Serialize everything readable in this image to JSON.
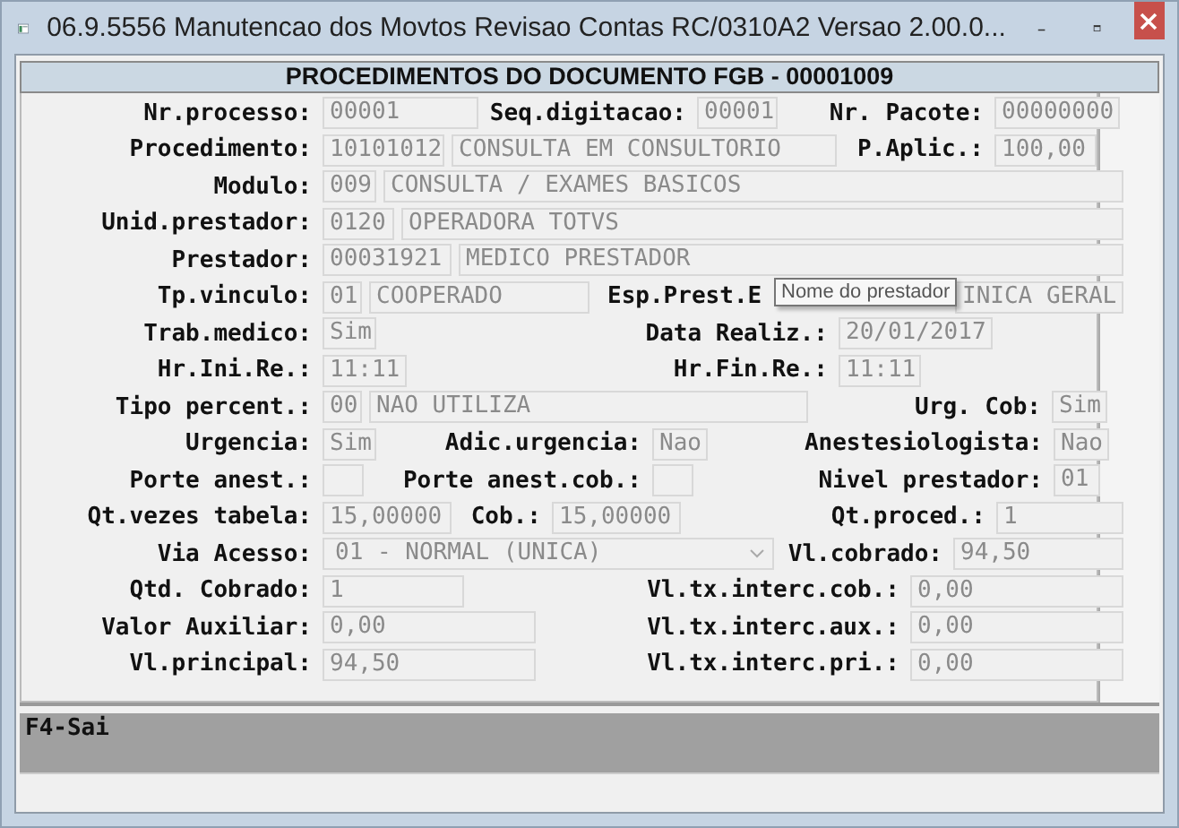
{
  "window": {
    "title": "06.9.5556 Manutencao  dos Movtos Revisao Contas RC/0310A2 Versao 2.00.0..."
  },
  "header": "PROCEDIMENTOS DO DOCUMENTO FGB - 00001009",
  "form_rows": [
    [
      {
        "label": "Nr.processo:",
        "kind": "text",
        "values": [
          "00001"
        ]
      },
      {
        "label": "Seq.digitacao:",
        "kind": "text",
        "values": [
          "00001"
        ]
      },
      {
        "label": "Nr. Pacote:",
        "kind": "text",
        "values": [
          "00000000"
        ]
      }
    ],
    [
      {
        "label": "Procedimento:",
        "kind": "text",
        "values": [
          "10101012",
          "CONSULTA EM CONSULTORIO"
        ]
      },
      {
        "label": "P.Aplic.:",
        "kind": "text",
        "values": [
          "100,00"
        ]
      }
    ],
    [
      {
        "label": "Modulo:",
        "kind": "text",
        "values": [
          "009",
          "CONSULTA / EXAMES BASICOS"
        ]
      }
    ],
    [
      {
        "label": "Unid.prestador:",
        "kind": "text",
        "values": [
          "0120",
          "OPERADORA TOTVS"
        ]
      }
    ],
    [
      {
        "label": "Prestador:",
        "kind": "text",
        "values": [
          "00031921",
          "MEDICO PRESTADOR"
        ]
      }
    ],
    [
      {
        "label": "Tp.vinculo:",
        "kind": "text",
        "values": [
          "01",
          "COOPERADO"
        ]
      },
      {
        "label": "Esp.Prest.E",
        "kind": "text",
        "values": [
          "INICA GERAL"
        ]
      }
    ],
    [
      {
        "label": "Trab.medico:",
        "kind": "text",
        "values": [
          "Sim"
        ]
      },
      {
        "label": "Data Realiz.:",
        "kind": "text",
        "values": [
          "20/01/2017"
        ]
      }
    ],
    [
      {
        "label": "Hr.Ini.Re.:",
        "kind": "text",
        "values": [
          "11:11"
        ]
      },
      {
        "label": "Hr.Fin.Re.:",
        "kind": "text",
        "values": [
          "11:11"
        ]
      }
    ],
    [
      {
        "label": "Tipo percent.:",
        "kind": "text",
        "values": [
          "00",
          "NAO UTILIZA"
        ]
      },
      {
        "label": "Urg. Cob:",
        "kind": "text",
        "values": [
          "Sim"
        ]
      }
    ],
    [
      {
        "label": "Urgencia:",
        "kind": "text",
        "values": [
          "Sim"
        ]
      },
      {
        "label": "Adic.urgencia:",
        "kind": "text",
        "values": [
          "Nao"
        ]
      },
      {
        "label": "Anestesiologista:",
        "kind": "text",
        "values": [
          "Nao"
        ]
      }
    ],
    [
      {
        "label": "Porte anest.:",
        "kind": "empty"
      },
      {
        "label": "Porte anest.cob.:",
        "kind": "empty"
      },
      {
        "label": "Nivel prestador:",
        "kind": "text",
        "values": [
          "01"
        ]
      }
    ],
    [
      {
        "label": "Qt.vezes tabela:",
        "kind": "text",
        "values": [
          "15,00000"
        ]
      },
      {
        "label": "Cob.:",
        "kind": "text",
        "values": [
          "15,00000"
        ]
      },
      {
        "label": "Qt.proced.:",
        "kind": "text",
        "values": [
          "1"
        ]
      }
    ],
    [
      {
        "label": "Via Acesso:",
        "kind": "combo",
        "values": [
          "01 - NORMAL (UNICA)"
        ]
      },
      {
        "label": "Vl.cobrado:",
        "kind": "text",
        "values": [
          "94,50"
        ]
      }
    ],
    [
      {
        "label": "Qtd. Cobrado:",
        "kind": "text",
        "values": [
          "1"
        ]
      },
      {
        "label": "Vl.tx.interc.cob.:",
        "kind": "text",
        "values": [
          "0,00"
        ]
      }
    ],
    [
      {
        "label": "Valor Auxiliar:",
        "kind": "text",
        "values": [
          "0,00"
        ]
      },
      {
        "label": "Vl.tx.interc.aux.:",
        "kind": "text",
        "values": [
          "0,00"
        ]
      }
    ],
    [
      {
        "label": "Vl.principal:",
        "kind": "text",
        "values": [
          "94,50"
        ]
      },
      {
        "label": "Vl.tx.interc.pri.:",
        "kind": "text",
        "values": [
          "0,00"
        ]
      }
    ]
  ],
  "tooltip": "Nome do prestador",
  "status_bar": "F4-Sai"
}
